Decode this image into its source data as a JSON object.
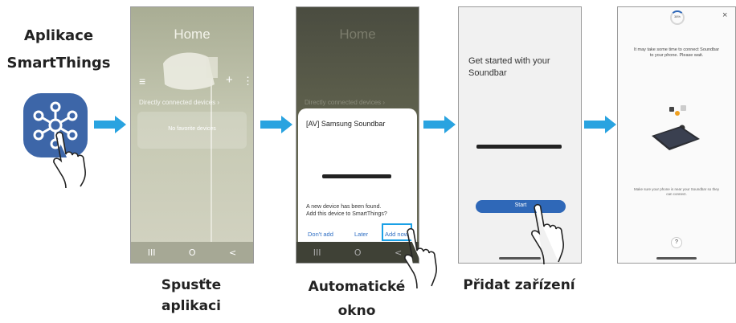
{
  "app": {
    "title_line1": "Aplikace",
    "title_line2": "SmartThings",
    "icon": "smartthings-app-icon",
    "icon_color": "#3d66a8"
  },
  "steps": {
    "step1": {
      "caption": "Spusťte aplikaci"
    },
    "step2": {
      "caption_line1": "Automatické",
      "caption_line2": "okno"
    },
    "step3": {
      "caption": "Přidat zařízení"
    }
  },
  "screen1": {
    "title": "Home",
    "menu_icon": "≡",
    "add_icon": "+",
    "more_icon": "⋮",
    "section_label": "Directly connected devices  ›",
    "empty_text": "No favorite devices",
    "nav": [
      "III",
      "O",
      "<"
    ]
  },
  "screen2": {
    "title": "Home",
    "section_label": "Directly connected devices  ›",
    "dialog_title": "[AV] Samsung Soundbar",
    "dialog_msg_line1": "A new device has been found.",
    "dialog_msg_line2": "Add this device to SmartThings?",
    "btn_dont_add": "Don't add",
    "btn_later": "Later",
    "btn_add_now": "Add now",
    "nav": [
      "III",
      "O",
      "<"
    ]
  },
  "screen3": {
    "heading_line1": "Get started with your",
    "heading_line2": "Soundbar",
    "start_label": "Start"
  },
  "screen4": {
    "progress": "38%",
    "close_icon": "×",
    "msg_line1": "It may take some time to connect Soundbar",
    "msg_line2": "to your phone. Please wait.",
    "hint_line1": "Make sure your phone is near your Soundbar so they",
    "hint_line2": "can connect.",
    "help_label": "?"
  },
  "colors": {
    "arrow": "#29a3e0",
    "highlight": "#1aa0e6",
    "start_button": "#2f68b8",
    "dialog_link": "#2f6fc4"
  }
}
